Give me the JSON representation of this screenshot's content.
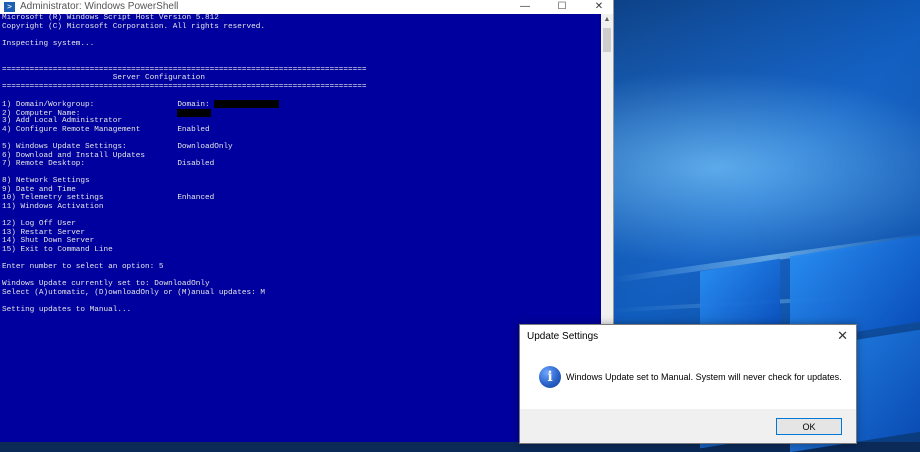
{
  "window": {
    "title": "Administrator: Windows PowerShell",
    "icon_glyph": ">",
    "minimize_glyph": "—",
    "maximize_glyph": "☐",
    "close_glyph": "✕"
  },
  "console": {
    "background_color": "#00009e",
    "text_color": "#e6e6e6",
    "header": [
      "Microsoft (R) Windows Script Host Version 5.812",
      "Copyright (C) Microsoft Corporation. All rights reserved."
    ],
    "inspecting": "Inspecting system...",
    "rule": "===============================================================================",
    "banner": "                        Server Configuration",
    "menu_group1": [
      {
        "label": "1) Domain/Workgroup:",
        "value": "Domain:"
      },
      {
        "label": "2) Computer Name:",
        "value": ""
      },
      {
        "label": "3) Add Local Administrator",
        "value": ""
      },
      {
        "label": "4) Configure Remote Management",
        "value": "Enabled"
      }
    ],
    "menu_group2": [
      {
        "label": "5) Windows Update Settings:",
        "value": "DownloadOnly"
      },
      {
        "label": "6) Download and Install Updates",
        "value": ""
      },
      {
        "label": "7) Remote Desktop:",
        "value": "Disabled"
      }
    ],
    "menu_group3": [
      {
        "label": "8) Network Settings",
        "value": ""
      },
      {
        "label": "9) Date and Time",
        "value": ""
      },
      {
        "label": "10) Telemetry settings",
        "value": "Enhanced"
      },
      {
        "label": "11) Windows Activation",
        "value": ""
      }
    ],
    "menu_group4": [
      "12) Log Off User",
      "13) Restart Server",
      "14) Shut Down Server",
      "15) Exit to Command Line"
    ],
    "prompt": "Enter number to select an option: 5",
    "wu_current": "Windows Update currently set to: DownloadOnly",
    "wu_select": "Select (A)utomatic, (D)ownloadOnly or (M)anual updates: M",
    "setting": "Setting updates to Manual..."
  },
  "dialog": {
    "title": "Update Settings",
    "close_glyph": "✕",
    "info_glyph": "i",
    "message": "Windows Update set to Manual.  System will never check for updates.",
    "ok_label": "OK"
  },
  "scrollbar": {
    "up_glyph": "▲"
  }
}
